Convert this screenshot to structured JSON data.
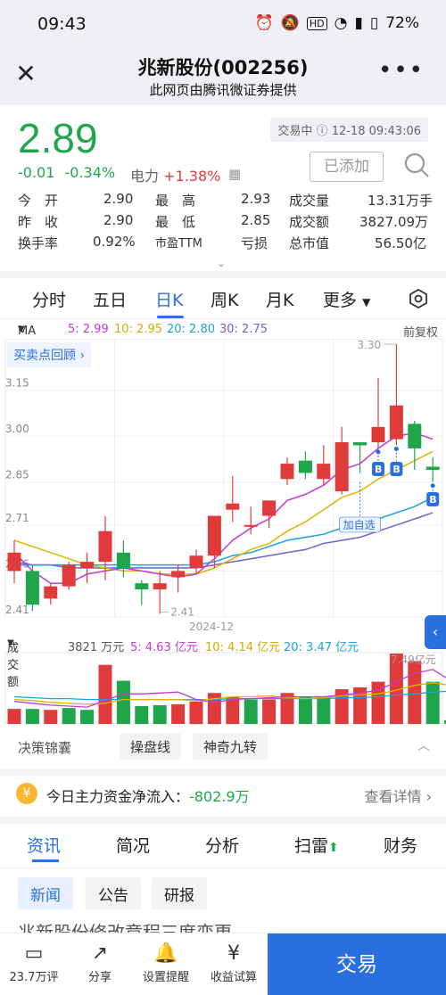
{
  "status": {
    "time": "09:43",
    "battery": "72%"
  },
  "header": {
    "title": "兆新股份(002256)",
    "subtitle": "此网页由腾讯微证券提供",
    "more_label": "•••"
  },
  "quote": {
    "price": "2.89",
    "change": "-0.01",
    "change_pct": "-0.34%",
    "sector_name": "电力",
    "sector_change": "+1.38%",
    "trade_status": "交易中",
    "trade_time": "12-18 09:43:06",
    "added_label": "已添加",
    "stats": [
      {
        "l1": "今　开",
        "v1": "2.90",
        "l2": "最　高",
        "v2": "2.93",
        "l3": "成交量",
        "v3": "13.31万手"
      },
      {
        "l1": "昨　收",
        "v1": "2.90",
        "l2": "最　低",
        "v2": "2.85",
        "l3": "成交额",
        "v3": "3827.09万"
      },
      {
        "l1": "换手率",
        "v1": "0.92%",
        "l2": "市盈TTM",
        "v2": "亏损",
        "l3": "总市值",
        "v3": "56.50亿"
      }
    ]
  },
  "chart_tabs": [
    "分时",
    "五日",
    "日K",
    "周K",
    "月K",
    "更多"
  ],
  "chart_tabs_active": "日K",
  "ma_legend": {
    "label": "MA",
    "ma5": "5: 2.99",
    "ma10": "10: 2.95",
    "ma20": "20: 2.80",
    "ma30": "30: 2.75",
    "adjust": "前复权"
  },
  "buy_sell_review": "买卖点回顾 ›",
  "add_watch_label": "加自选",
  "month_label": "2024-12",
  "colors": {
    "up": "#e03b3b",
    "down": "#1fa64a",
    "accent": "#2a6fe0",
    "ma5": "#c23ad3",
    "ma10": "#e0b400",
    "ma20": "#1aa3d9",
    "ma30": "#7a5fc4"
  },
  "chart_data": [
    {
      "type": "candlestick",
      "title": "日K",
      "xlabel": "2024-12",
      "y_ticks": [
        "3.15",
        "3.00",
        "2.85",
        "2.71",
        "2.56",
        "2.41"
      ],
      "ylim": [
        2.41,
        3.3
      ],
      "high_label": "3.30",
      "low_label": "2.41",
      "candles": [
        {
          "open": 2.56,
          "close": 2.62,
          "high": 2.66,
          "low": 2.52
        },
        {
          "open": 2.56,
          "close": 2.45,
          "high": 2.58,
          "low": 2.43
        },
        {
          "open": 2.47,
          "close": 2.51,
          "high": 2.52,
          "low": 2.45
        },
        {
          "open": 2.51,
          "close": 2.58,
          "high": 2.59,
          "low": 2.5
        },
        {
          "open": 2.57,
          "close": 2.59,
          "high": 2.62,
          "low": 2.52
        },
        {
          "open": 2.59,
          "close": 2.69,
          "high": 2.74,
          "low": 2.53
        },
        {
          "open": 2.62,
          "close": 2.57,
          "high": 2.66,
          "low": 2.54
        },
        {
          "open": 2.52,
          "close": 2.5,
          "high": 2.53,
          "low": 2.45
        },
        {
          "open": 2.5,
          "close": 2.52,
          "high": 2.56,
          "low": 2.42
        },
        {
          "open": 2.54,
          "close": 2.56,
          "high": 2.58,
          "low": 2.49
        },
        {
          "open": 2.57,
          "close": 2.61,
          "high": 2.63,
          "low": 2.55
        },
        {
          "open": 2.61,
          "close": 2.74,
          "high": 2.74,
          "low": 2.57
        },
        {
          "open": 2.76,
          "close": 2.78,
          "high": 2.87,
          "low": 2.72
        },
        {
          "open": 2.71,
          "close": 2.71,
          "high": 2.77,
          "low": 2.68
        },
        {
          "open": 2.74,
          "close": 2.79,
          "high": 2.79,
          "low": 2.7
        },
        {
          "open": 2.86,
          "close": 2.91,
          "high": 2.93,
          "low": 2.84
        },
        {
          "open": 2.92,
          "close": 2.88,
          "high": 2.95,
          "low": 2.86
        },
        {
          "open": 2.86,
          "close": 2.91,
          "high": 2.97,
          "low": 2.84
        },
        {
          "open": 2.82,
          "close": 2.98,
          "high": 3.03,
          "low": 2.81
        },
        {
          "open": 2.98,
          "close": 2.97,
          "high": 2.98,
          "low": 2.88
        },
        {
          "open": 2.98,
          "close": 3.03,
          "high": 3.19,
          "low": 2.96
        },
        {
          "open": 2.99,
          "close": 3.1,
          "high": 3.3,
          "low": 2.97
        },
        {
          "open": 3.04,
          "close": 2.96,
          "high": 3.05,
          "low": 2.89
        },
        {
          "open": 2.9,
          "close": 2.89,
          "high": 2.93,
          "low": 2.85
        }
      ],
      "ma5": [
        2.62,
        2.56,
        2.52,
        2.52,
        2.55,
        2.56,
        2.57,
        2.56,
        2.55,
        2.54,
        2.55,
        2.6,
        2.66,
        2.7,
        2.73,
        2.79,
        2.81,
        2.84,
        2.89,
        2.91,
        2.96,
        3.0,
        3.01,
        2.99
      ],
      "ma10": [
        2.66,
        2.64,
        2.62,
        2.6,
        2.58,
        2.57,
        2.56,
        2.56,
        2.55,
        2.55,
        2.55,
        2.57,
        2.6,
        2.63,
        2.65,
        2.69,
        2.72,
        2.76,
        2.8,
        2.82,
        2.86,
        2.89,
        2.92,
        2.95
      ],
      "ma20": [
        2.58,
        2.58,
        2.58,
        2.58,
        2.58,
        2.58,
        2.58,
        2.58,
        2.58,
        2.58,
        2.58,
        2.59,
        2.61,
        2.62,
        2.64,
        2.66,
        2.67,
        2.68,
        2.7,
        2.71,
        2.73,
        2.75,
        2.77,
        2.8
      ],
      "ma30": [
        2.59,
        2.58,
        2.58,
        2.57,
        2.57,
        2.57,
        2.57,
        2.57,
        2.57,
        2.57,
        2.57,
        2.58,
        2.59,
        2.6,
        2.61,
        2.62,
        2.63,
        2.65,
        2.66,
        2.67,
        2.69,
        2.71,
        2.73,
        2.75
      ]
    },
    {
      "type": "bar",
      "title": "成交额",
      "legend": {
        "label": "成交额",
        "amount": "3821 万元",
        "ma5": "5: 4.63 亿元",
        "ma10": "10: 4.14 亿元",
        "ma20": "20: 3.47 亿元"
      },
      "max_label": "7.49亿元",
      "values": [
        1.6,
        1.6,
        1.5,
        1.7,
        1.5,
        6.3,
        4.6,
        1.9,
        2.0,
        2.1,
        2.4,
        3.3,
        2.9,
        2.6,
        2.6,
        3.3,
        2.9,
        2.9,
        3.7,
        3.9,
        4.5,
        7.5,
        6.7,
        4.5,
        0.4
      ],
      "up": [
        true,
        false,
        true,
        false,
        false,
        true,
        false,
        false,
        false,
        true,
        true,
        true,
        true,
        false,
        true,
        true,
        false,
        false,
        true,
        true,
        true,
        true,
        true,
        false,
        false
      ],
      "ma5": [
        2.4,
        2.2,
        2.0,
        1.9,
        1.8,
        2.5,
        3.2,
        3.2,
        3.3,
        3.4,
        2.6,
        2.3,
        2.6,
        2.7,
        2.8,
        2.9,
        2.9,
        2.9,
        3.1,
        3.3,
        3.6,
        4.5,
        5.4,
        5.8,
        4.6
      ],
      "ma10": [
        2.6,
        2.5,
        2.3,
        2.2,
        2.1,
        2.2,
        2.6,
        2.6,
        2.6,
        2.6,
        2.5,
        2.7,
        2.9,
        2.9,
        3.0,
        2.8,
        2.7,
        2.8,
        3.0,
        3.1,
        3.2,
        3.6,
        4.1,
        4.4,
        4.1
      ],
      "ma20": [
        2.9,
        2.8,
        2.7,
        2.7,
        2.6,
        2.6,
        2.6,
        2.6,
        2.6,
        2.6,
        2.6,
        2.6,
        2.7,
        2.7,
        2.7,
        2.7,
        2.7,
        2.7,
        2.8,
        2.8,
        2.9,
        3.1,
        3.2,
        3.4,
        3.5
      ]
    }
  ],
  "decision": {
    "label": "决策锦囊",
    "pill1": "操盘线",
    "pill2": "神奇九转"
  },
  "fund": {
    "yen": "¥",
    "text": "今日主力资金净流入：",
    "value": "-802.9万",
    "detail": "查看详情 ›"
  },
  "news_tabs": [
    "资讯",
    "简况",
    "分析",
    "扫雷",
    "财务"
  ],
  "sub_tabs": [
    "新闻",
    "公告",
    "研报"
  ],
  "news_preview": "兆新股份修改章程三度变更...",
  "bottom": {
    "comments": "23.7万评",
    "share": "分享",
    "alert": "设置提醒",
    "profit": "收益试算",
    "trade": "交易"
  }
}
